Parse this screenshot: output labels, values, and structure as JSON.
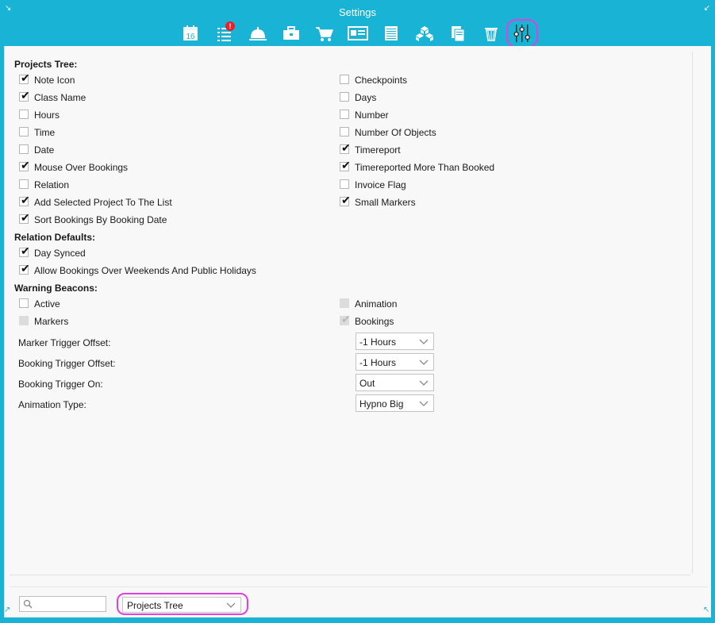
{
  "window": {
    "title": "Settings"
  },
  "toolbar": {
    "items": [
      {
        "icon": "calendar-icon",
        "label": "16"
      },
      {
        "icon": "task-list-icon",
        "badge": "!"
      },
      {
        "icon": "service-bell-icon"
      },
      {
        "icon": "briefcase-icon"
      },
      {
        "icon": "shopping-cart-icon"
      },
      {
        "icon": "id-card-icon"
      },
      {
        "icon": "ledger-icon"
      },
      {
        "icon": "cubes-icon"
      },
      {
        "icon": "documents-icon"
      },
      {
        "icon": "trash-icon"
      },
      {
        "icon": "sliders-icon",
        "active": true
      }
    ]
  },
  "sections": {
    "projects_tree": {
      "title": "Projects Tree:",
      "left": [
        {
          "label": "Note Icon",
          "checked": true
        },
        {
          "label": "Class Name",
          "checked": true
        },
        {
          "label": "Hours",
          "checked": false
        },
        {
          "label": "Time",
          "checked": false
        },
        {
          "label": "Date",
          "checked": false
        },
        {
          "label": "Mouse Over Bookings",
          "checked": true
        },
        {
          "label": "Relation",
          "checked": false
        },
        {
          "label": "Add Selected Project To The List",
          "checked": true
        },
        {
          "label": "Sort Bookings By Booking Date",
          "checked": true
        }
      ],
      "right": [
        {
          "label": "Checkpoints",
          "checked": false
        },
        {
          "label": "Days",
          "checked": false
        },
        {
          "label": "Number",
          "checked": false
        },
        {
          "label": "Number Of Objects",
          "checked": false
        },
        {
          "label": "Timereport",
          "checked": true
        },
        {
          "label": "Timereported More Than Booked",
          "checked": true
        },
        {
          "label": "Invoice Flag",
          "checked": false
        },
        {
          "label": "Small Markers",
          "checked": true
        }
      ]
    },
    "relation_defaults": {
      "title": "Relation Defaults:",
      "items": [
        {
          "label": "Day Synced",
          "checked": true
        },
        {
          "label": "Allow Bookings Over Weekends And Public Holidays",
          "checked": true
        }
      ]
    },
    "warning_beacons": {
      "title": "Warning Beacons:",
      "left": [
        {
          "label": "Active",
          "checked": false,
          "disabled": false
        },
        {
          "label": "Markers",
          "checked": false,
          "disabled": true
        }
      ],
      "right": [
        {
          "label": "Animation",
          "checked": false,
          "disabled": true
        },
        {
          "label": "Bookings",
          "checked": true,
          "disabled": true
        }
      ],
      "fields": [
        {
          "label": "Marker Trigger Offset:",
          "value": "-1 Hours"
        },
        {
          "label": "Booking Trigger Offset:",
          "value": "-1 Hours"
        },
        {
          "label": "Booking Trigger On:",
          "value": "Out"
        },
        {
          "label": "Animation Type:",
          "value": "Hypno Big"
        }
      ]
    }
  },
  "footer": {
    "search": {
      "placeholder": "",
      "value": ""
    },
    "section_select": {
      "value": "Projects Tree"
    }
  },
  "colors": {
    "titlebar": "#19b3d6",
    "highlight": "#e040e0",
    "badge": "#e8212d"
  }
}
